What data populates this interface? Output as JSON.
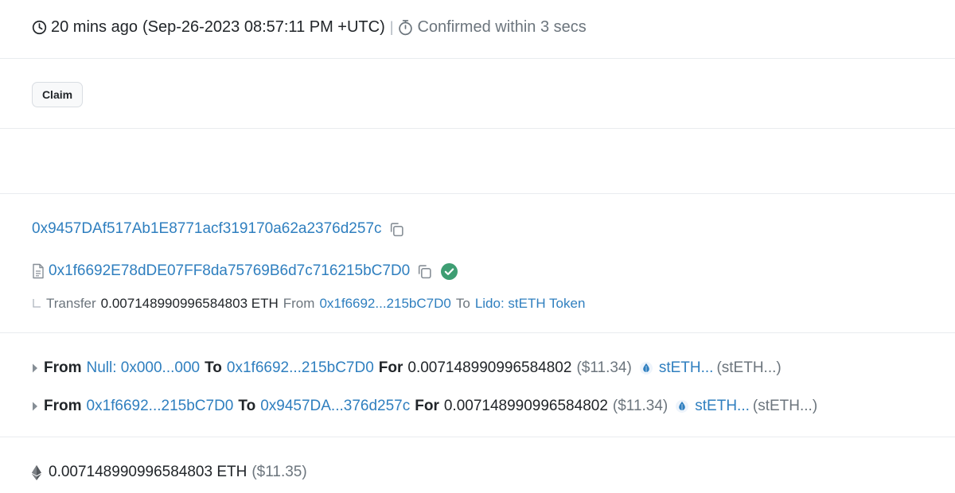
{
  "header": {
    "time_ago": "20 mins ago",
    "timestamp": "(Sep-26-2023 08:57:11 PM +UTC)",
    "separator": "|",
    "confirmed": "Confirmed within 3 secs"
  },
  "method": {
    "label": "Claim"
  },
  "from_address": "0x9457DAf517Ab1E8771acf319170a62a2376d257c",
  "contract": {
    "address": "0x1f6692E78dDE07FF8da75769B6d7c716215bC7D0",
    "transfer": {
      "label": "Transfer",
      "amount": "0.007148990996584803 ETH",
      "from_label": "From",
      "from_addr": "0x1f6692...215bC7D0",
      "to_label": "To",
      "to_addr": "Lido: stETH Token"
    }
  },
  "token_transfers": [
    {
      "from_label": "From",
      "from": "Null: 0x000...000",
      "to_label": "To",
      "to": "0x1f6692...215bC7D0",
      "for_label": "For",
      "amount": "0.007148990996584802",
      "usd": "($11.34)",
      "token": "stETH...",
      "symbol": "(stETH...)"
    },
    {
      "from_label": "From",
      "from": "0x1f6692...215bC7D0",
      "to_label": "To",
      "to": "0x9457DA...376d257c",
      "for_label": "For",
      "amount": "0.007148990996584802",
      "usd": "($11.34)",
      "token": "stETH...",
      "symbol": "(stETH...)"
    }
  ],
  "value": {
    "amount": "0.007148990996584803 ETH",
    "usd": "($11.35)"
  },
  "colors": {
    "link": "#2f7fbf",
    "text": "#212529",
    "muted": "#6c757d",
    "success": "#3e9e73",
    "divider": "#e9ecef"
  },
  "icons": {
    "clock": "clock-icon",
    "stopwatch": "stopwatch-icon",
    "copy": "copy-icon",
    "file": "file-icon",
    "verified": "check-circle-icon",
    "caret": "caret-right-icon",
    "steth": "steth-drop-icon",
    "eth": "ethereum-icon"
  }
}
